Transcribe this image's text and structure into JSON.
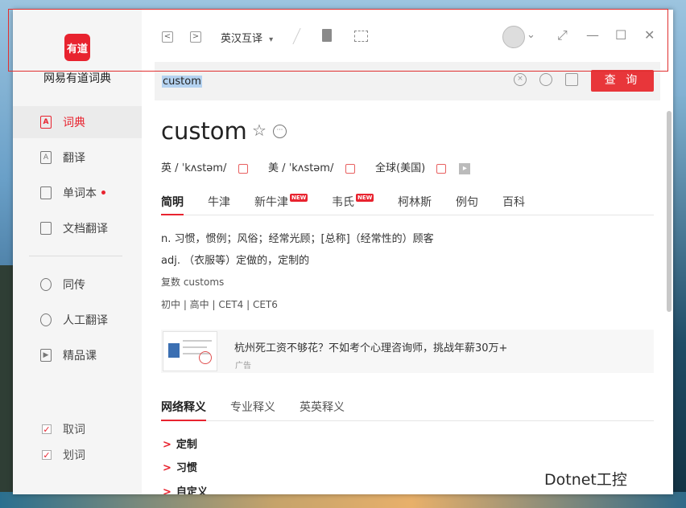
{
  "app": {
    "logo_text": "有道",
    "name": "网易有道词典"
  },
  "sidebar": {
    "items": [
      {
        "label": "词典",
        "icon": "dictionary-icon",
        "glyph": "A",
        "active": true
      },
      {
        "label": "翻译",
        "icon": "translate-icon",
        "glyph": "A"
      },
      {
        "label": "单词本",
        "icon": "wordbook-icon",
        "glyph": "",
        "has_dot": true
      },
      {
        "label": "文档翻译",
        "icon": "document-icon",
        "glyph": ""
      },
      {
        "label": "同传",
        "icon": "simultaneous-icon",
        "glyph": ""
      },
      {
        "label": "人工翻译",
        "icon": "human-translate-icon",
        "glyph": ""
      },
      {
        "label": "精品课",
        "icon": "course-icon",
        "glyph": "▶"
      }
    ],
    "checkboxes": [
      {
        "label": "取词",
        "checked": true
      },
      {
        "label": "划词",
        "checked": true
      }
    ]
  },
  "toolbar": {
    "back": "<",
    "forward": ">",
    "mode": "英汉互译",
    "mode_caret": "▾",
    "avatar_caret": "⌄",
    "restore": "⤢",
    "minimize": "—",
    "maximize": "☐",
    "close": "✕"
  },
  "search": {
    "query": "custom",
    "button": "查 询"
  },
  "entry": {
    "word": "custom",
    "star": "☆",
    "more": "···",
    "phonetics": [
      {
        "label": "英 / ˈkʌstəm/"
      },
      {
        "label": "美 / ˈkʌstəm/"
      },
      {
        "label": "全球(美国)"
      }
    ],
    "play": "▸",
    "tabs": [
      {
        "label": "简明",
        "active": true
      },
      {
        "label": "牛津"
      },
      {
        "label": "新牛津",
        "badge": "NEW"
      },
      {
        "label": "韦氏",
        "badge": "NEW"
      },
      {
        "label": "柯林斯"
      },
      {
        "label": "例句"
      },
      {
        "label": "百科"
      }
    ],
    "definitions": [
      "n. 习惯，惯例；风俗；经常光顾；[总称]（经常性的）顾客",
      "adj. （衣服等）定做的，定制的"
    ],
    "plural": "复数 customs",
    "levels": "初中 | 高中 | CET4 | CET6"
  },
  "ad": {
    "title": "杭州死工资不够花？不如考个心理咨询师，挑战年薪30万+",
    "label": "广告"
  },
  "tabs2": [
    {
      "label": "网络释义",
      "active": true
    },
    {
      "label": "专业释义"
    },
    {
      "label": "英英释义"
    }
  ],
  "web_defs": [
    "定制",
    "习惯",
    "自定义"
  ],
  "chevron": ">",
  "watermark": "Dotnet工控",
  "colors": {
    "accent": "#e8232f",
    "search_button": "#e8363a",
    "selection": "#b4d2f0"
  }
}
